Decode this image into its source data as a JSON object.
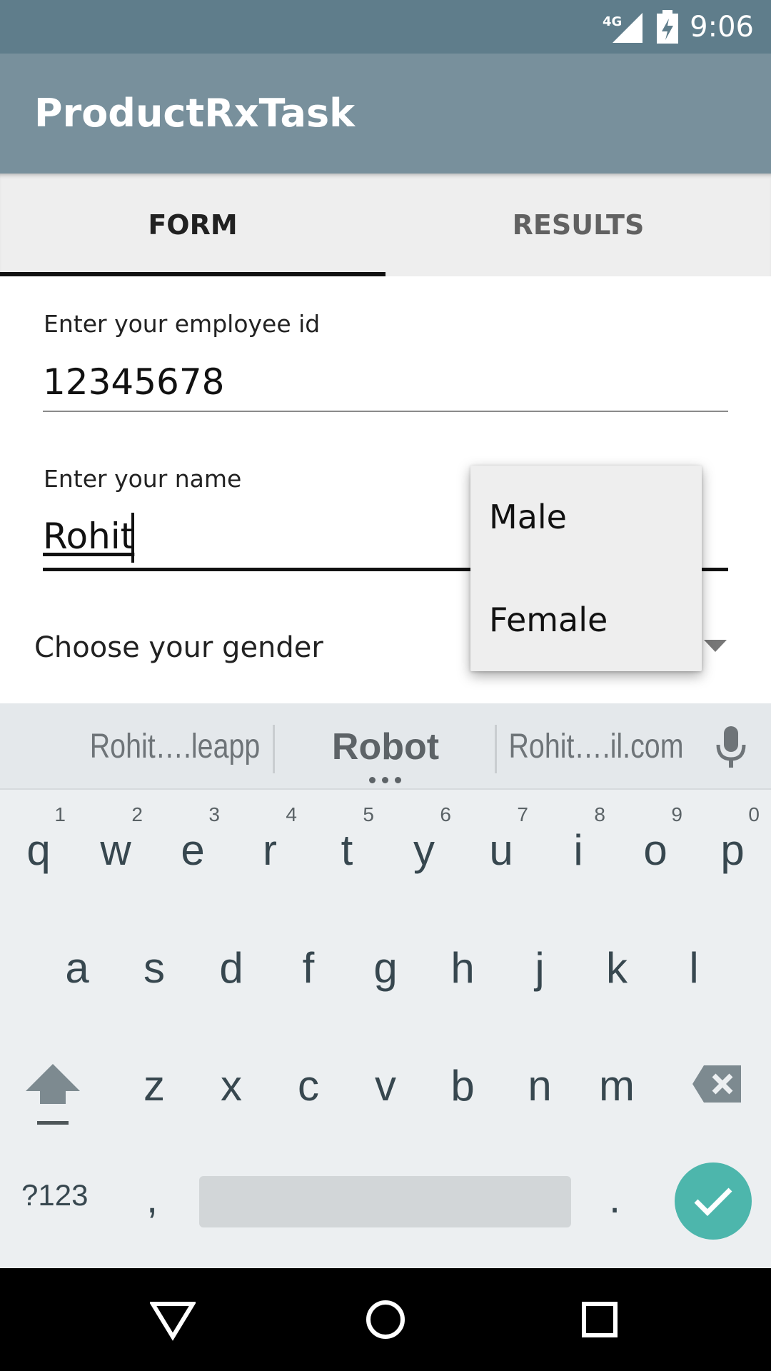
{
  "status_bar": {
    "time": "9:06",
    "network": "4G",
    "icons": [
      "signal-4g-icon",
      "battery-charging-icon"
    ]
  },
  "app_bar": {
    "title": "ProductRxTask"
  },
  "tabs": [
    {
      "label": "FORM",
      "selected": true
    },
    {
      "label": "RESULTS",
      "selected": false
    }
  ],
  "form": {
    "employee_id": {
      "label": "Enter your employee id",
      "value": "12345678"
    },
    "name": {
      "label": "Enter your name",
      "value": "Rohit"
    },
    "gender": {
      "label": "Choose your gender"
    }
  },
  "dropdown": {
    "options": [
      "Male",
      "Female"
    ]
  },
  "keyboard": {
    "suggestions": [
      "Rohit….leapp",
      "Robot",
      "Rohit….il.com"
    ],
    "row1": [
      {
        "ch": "q",
        "hint": "1"
      },
      {
        "ch": "w",
        "hint": "2"
      },
      {
        "ch": "e",
        "hint": "3"
      },
      {
        "ch": "r",
        "hint": "4"
      },
      {
        "ch": "t",
        "hint": "5"
      },
      {
        "ch": "y",
        "hint": "6"
      },
      {
        "ch": "u",
        "hint": "7"
      },
      {
        "ch": "i",
        "hint": "8"
      },
      {
        "ch": "o",
        "hint": "9"
      },
      {
        "ch": "p",
        "hint": "0"
      }
    ],
    "row2": [
      "a",
      "s",
      "d",
      "f",
      "g",
      "h",
      "j",
      "k",
      "l"
    ],
    "row3": [
      "z",
      "x",
      "c",
      "v",
      "b",
      "n",
      "m"
    ],
    "symbols_label": "?123",
    "comma": ",",
    "period": ".",
    "icons": [
      "shift-icon",
      "backspace-icon",
      "mic-icon",
      "checkmark-icon"
    ]
  },
  "nav_bar": {
    "icons": [
      "back-icon",
      "home-icon",
      "recents-icon"
    ]
  },
  "colors": {
    "status_bar": "#5f7d8b",
    "app_bar": "#78909c",
    "tab_bar": "#eeeeee",
    "keyboard": "#eceff1",
    "done_button": "#4db6ac"
  }
}
